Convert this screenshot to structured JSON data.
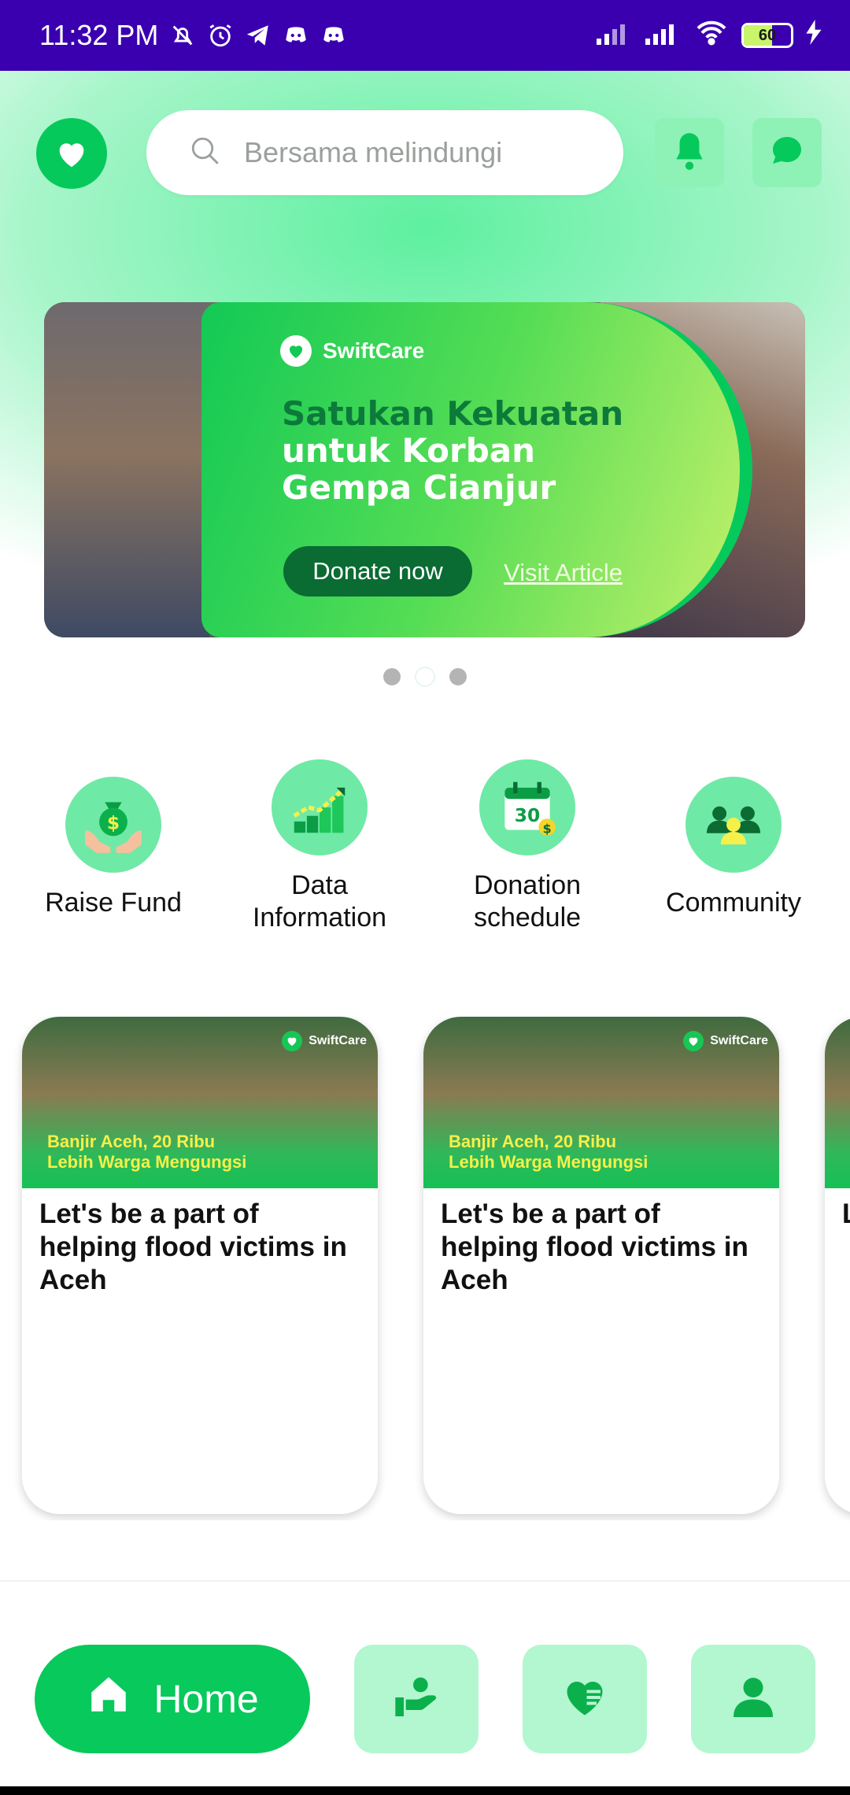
{
  "status_bar": {
    "time": "11:32 PM",
    "battery": "60",
    "icons": [
      "mute-bell-icon",
      "alarm-icon",
      "telegram-icon",
      "discord-icon",
      "discord-icon",
      "signal-icon",
      "signal-icon",
      "wifi-icon",
      "battery-icon",
      "charging-icon"
    ]
  },
  "header": {
    "search_placeholder": "Bersama melindungi",
    "icons": [
      "logo-heart-icon",
      "search-icon",
      "bell-icon",
      "chat-icon"
    ]
  },
  "banner": {
    "brand": "SwiftCare",
    "title_line1": "Satukan Kekuatan",
    "title_line2": "untuk Korban",
    "title_line3": "Gempa Cianjur",
    "donate_label": "Donate now",
    "visit_label": "Visit Article",
    "slide_count": 3,
    "active_slide": 2
  },
  "actions": [
    {
      "label": "Raise Fund",
      "icon": "money-bag-hands-icon"
    },
    {
      "label": "Data Information",
      "icon": "growth-chart-icon"
    },
    {
      "label": "Donation schedule",
      "icon": "calendar-icon"
    },
    {
      "label": "Community",
      "icon": "community-icon"
    }
  ],
  "cards": [
    {
      "title": "Let's be a part of helping flood victims in Aceh",
      "image_caption_line1": "Banjir Aceh, 20 Ribu",
      "image_caption_line2": "Lebih Warga Mengungsi",
      "badge": "SwiftCare"
    },
    {
      "title": "Let's be a part of helping flood victims in Aceh",
      "image_caption_line1": "Banjir Aceh, 20 Ribu",
      "image_caption_line2": "Lebih Warga Mengungsi",
      "badge": "SwiftCare"
    },
    {
      "title": "L f",
      "image_caption_line1": "",
      "image_caption_line2": "",
      "badge": ""
    }
  ],
  "nav": {
    "home_label": "Home",
    "items": [
      "home-icon",
      "donation-hand-icon",
      "heart-list-icon",
      "profile-icon"
    ]
  },
  "colors": {
    "status_bar": "#3a00b0",
    "brand_green": "#06c95c",
    "light_green": "#b2f7cf",
    "dark_green": "#0a6b33"
  }
}
